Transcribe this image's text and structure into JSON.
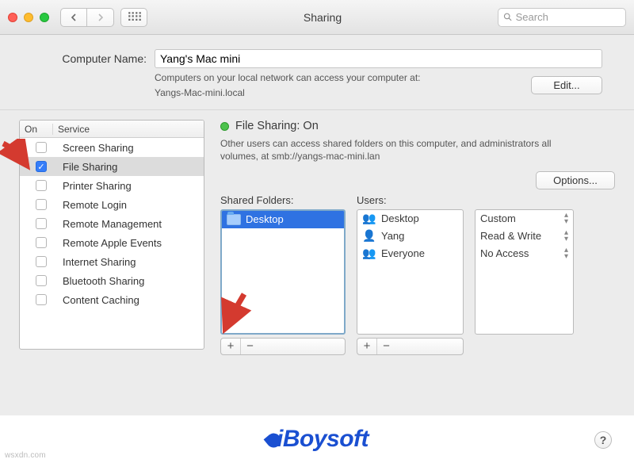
{
  "window": {
    "title": "Sharing",
    "search_placeholder": "Search"
  },
  "computer_name": {
    "label": "Computer Name:",
    "value": "Yang's Mac mini",
    "description": "Computers on your local network can access your computer at:",
    "hostname": "Yangs-Mac-mini.local",
    "edit_label": "Edit..."
  },
  "services": {
    "col_on": "On",
    "col_service": "Service",
    "items": [
      {
        "label": "Screen Sharing",
        "on": false,
        "selected": false
      },
      {
        "label": "File Sharing",
        "on": true,
        "selected": true
      },
      {
        "label": "Printer Sharing",
        "on": false,
        "selected": false
      },
      {
        "label": "Remote Login",
        "on": false,
        "selected": false
      },
      {
        "label": "Remote Management",
        "on": false,
        "selected": false
      },
      {
        "label": "Remote Apple Events",
        "on": false,
        "selected": false
      },
      {
        "label": "Internet Sharing",
        "on": false,
        "selected": false
      },
      {
        "label": "Bluetooth Sharing",
        "on": false,
        "selected": false
      },
      {
        "label": "Content Caching",
        "on": false,
        "selected": false
      }
    ]
  },
  "detail": {
    "status_title": "File Sharing: On",
    "status_desc": "Other users can access shared folders on this computer, and administrators all volumes, at smb://yangs-mac-mini.lan",
    "options_label": "Options...",
    "folders_label": "Shared Folders:",
    "users_label": "Users:",
    "folders": [
      {
        "label": "Desktop",
        "selected": true
      }
    ],
    "users": [
      {
        "label": "Desktop",
        "icon": "group"
      },
      {
        "label": "Yang",
        "icon": "user"
      },
      {
        "label": "Everyone",
        "icon": "group"
      }
    ],
    "perms": [
      {
        "label": "Custom",
        "selected": true
      },
      {
        "label": "Read & Write",
        "selected": false
      },
      {
        "label": "No Access",
        "selected": false
      }
    ],
    "plus": "+",
    "minus": "−"
  },
  "footer": {
    "brand": "iBoysoft",
    "watermark": "wsxdn.com",
    "help": "?"
  }
}
